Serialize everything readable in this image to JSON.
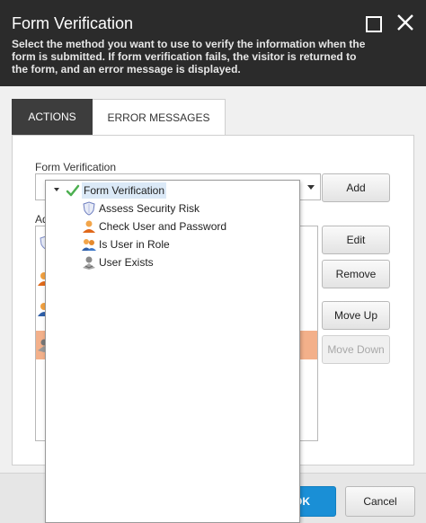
{
  "dialog": {
    "title": "Form Verification",
    "description": "Select the method you want to use to verify the information when the form is submitted. If form verification fails, the visitor is returned to the form, and an error message is displayed."
  },
  "tabs": [
    {
      "label": "ACTIONS",
      "active": true
    },
    {
      "label": "ERROR MESSAGES",
      "active": false
    }
  ],
  "form": {
    "verification_label": "Form Verification",
    "added_label": "Ad",
    "selected_value": ""
  },
  "buttons": {
    "add": "Add",
    "edit": "Edit",
    "remove": "Remove",
    "move_up": "Move Up",
    "move_down": "Move Down",
    "ok": "OK",
    "cancel": "Cancel"
  },
  "dropdown": {
    "root": {
      "label": "Form Verification",
      "icon": "checkmark-icon"
    },
    "items": [
      {
        "label": "Assess Security Risk",
        "icon": "shield-icon"
      },
      {
        "label": "Check User and Password",
        "icon": "user-icon"
      },
      {
        "label": "Is User in Role",
        "icon": "users-role-icon"
      },
      {
        "label": "User Exists",
        "icon": "user-exists-icon"
      }
    ]
  },
  "colors": {
    "header_bg": "#2b2b2b",
    "accent": "#1a8fd6",
    "selected_row": "#f3b08a",
    "tab_active_bg": "#3d3d3d"
  }
}
